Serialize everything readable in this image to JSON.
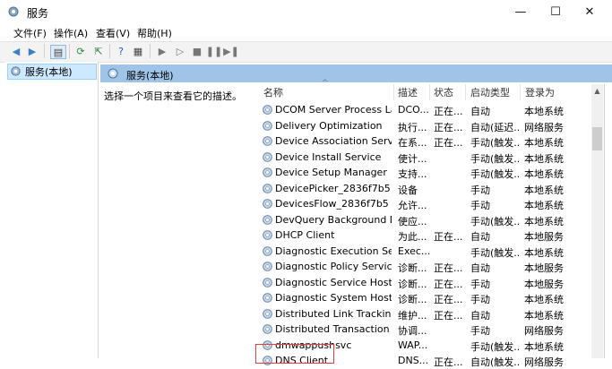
{
  "window": {
    "title": "服务",
    "minimize": "—",
    "maximize": "☐",
    "close": "✕"
  },
  "menu": [
    "文件(F)",
    "操作(A)",
    "查看(V)",
    "帮助(H)"
  ],
  "tree": {
    "selected": "服务(本地)"
  },
  "content": {
    "header": "服务(本地)",
    "description": "选择一个项目来查看它的描述。"
  },
  "columns": {
    "name": "名称",
    "desc": "描述",
    "status": "状态",
    "startup": "启动类型",
    "logon": "登录为"
  },
  "services": [
    {
      "name": "DCOM Server Process La...",
      "desc": "DCO...",
      "status": "正在...",
      "startup": "自动",
      "logon": "本地系统"
    },
    {
      "name": "Delivery Optimization",
      "desc": "执行...",
      "status": "正在...",
      "startup": "自动(延迟...",
      "logon": "网络服务"
    },
    {
      "name": "Device Association Service",
      "desc": "在系...",
      "status": "正在...",
      "startup": "手动(触发...",
      "logon": "本地系统"
    },
    {
      "name": "Device Install Service",
      "desc": "使计...",
      "status": "",
      "startup": "手动(触发...",
      "logon": "本地系统"
    },
    {
      "name": "Device Setup Manager",
      "desc": "支持...",
      "status": "",
      "startup": "手动(触发...",
      "logon": "本地系统"
    },
    {
      "name": "DevicePicker_2836f7b5",
      "desc": "设备",
      "status": "",
      "startup": "手动",
      "logon": "本地系统"
    },
    {
      "name": "DevicesFlow_2836f7b5",
      "desc": "允许...",
      "status": "",
      "startup": "手动",
      "logon": "本地系统"
    },
    {
      "name": "DevQuery Background D...",
      "desc": "使应...",
      "status": "",
      "startup": "手动(触发...",
      "logon": "本地系统"
    },
    {
      "name": "DHCP Client",
      "desc": "为此...",
      "status": "正在...",
      "startup": "自动",
      "logon": "本地服务"
    },
    {
      "name": "Diagnostic Execution Ser...",
      "desc": "Exec...",
      "status": "",
      "startup": "手动(触发...",
      "logon": "本地系统"
    },
    {
      "name": "Diagnostic Policy Service",
      "desc": "诊断...",
      "status": "正在...",
      "startup": "自动",
      "logon": "本地服务"
    },
    {
      "name": "Diagnostic Service Host",
      "desc": "诊断...",
      "status": "正在...",
      "startup": "手动",
      "logon": "本地服务"
    },
    {
      "name": "Diagnostic System Host",
      "desc": "诊断...",
      "status": "正在...",
      "startup": "手动",
      "logon": "本地系统"
    },
    {
      "name": "Distributed Link Tracking...",
      "desc": "维护...",
      "status": "正在...",
      "startup": "自动",
      "logon": "本地系统"
    },
    {
      "name": "Distributed Transaction C...",
      "desc": "协调...",
      "status": "",
      "startup": "手动",
      "logon": "网络服务"
    },
    {
      "name": "dmwappushsvc",
      "desc": "WAP...",
      "status": "",
      "startup": "手动(触发...",
      "logon": "本地系统"
    },
    {
      "name": "DNS Client",
      "desc": "DNS...",
      "status": "正在...",
      "startup": "自动(触发...",
      "logon": "网络服务"
    }
  ],
  "colors": {
    "header_bg": "#9fc4e8",
    "selection_bg": "#cde8ff",
    "highlight_border": "#e04040"
  }
}
